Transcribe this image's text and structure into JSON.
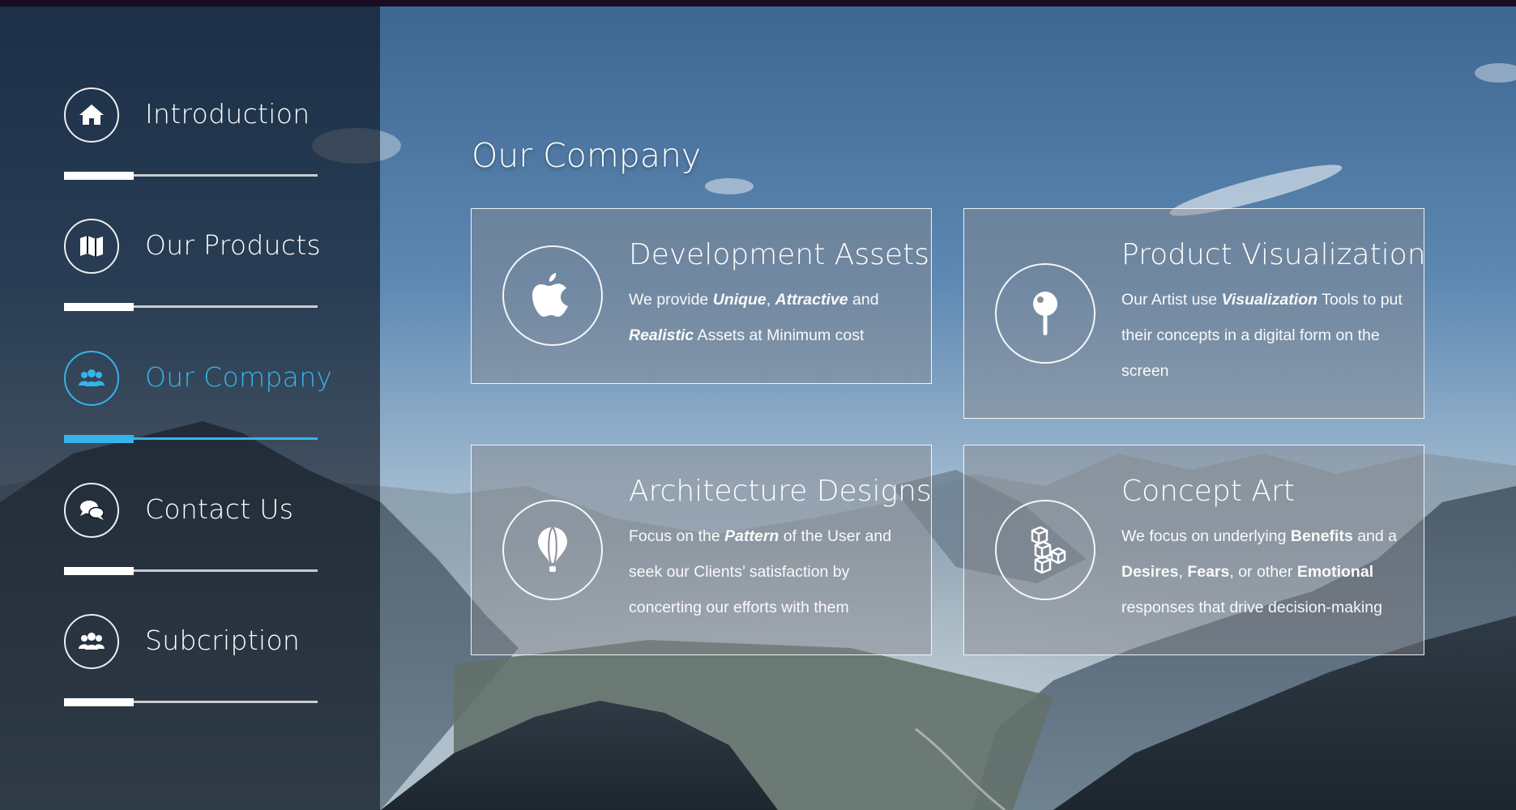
{
  "sidebar": {
    "items": [
      {
        "label": "Introduction",
        "icon": "home-icon"
      },
      {
        "label": "Our Products",
        "icon": "map-icon"
      },
      {
        "label": "Our Company",
        "icon": "users-icon",
        "active": true
      },
      {
        "label": "Contact Us",
        "icon": "chat-icon"
      },
      {
        "label": "Subcription",
        "icon": "users-icon"
      }
    ]
  },
  "main": {
    "title": "Our Company",
    "cards": [
      {
        "title": "Development Assets",
        "icon": "apple-icon",
        "text": [
          "We provide ",
          "Unique",
          ", ",
          "Attractive",
          " and ",
          "Realistic",
          " Assets at Minimum cost"
        ]
      },
      {
        "title": "Product Visualization",
        "icon": "pin-icon",
        "text": [
          "Our Artist use ",
          "Visualization",
          " Tools to put their concepts in a digital form on the screen"
        ]
      },
      {
        "title": "Architecture Designs",
        "icon": "balloon-icon",
        "text": [
          "Focus on the ",
          "Pattern",
          " of the User and seek our Clients’ satisfaction by concerting our efforts with them"
        ]
      },
      {
        "title": "Concept Art",
        "icon": "cubes-icon",
        "text": [
          "We focus on underlying ",
          "Benefits",
          " and a ",
          "Desires",
          ", ",
          "Fears",
          ", or other ",
          "Emotional",
          " responses that drive decision-making"
        ]
      }
    ]
  },
  "colors": {
    "accent": "#35b4ec",
    "sidebar_bg": "#080e1a",
    "topbar": "#1a0c24"
  }
}
